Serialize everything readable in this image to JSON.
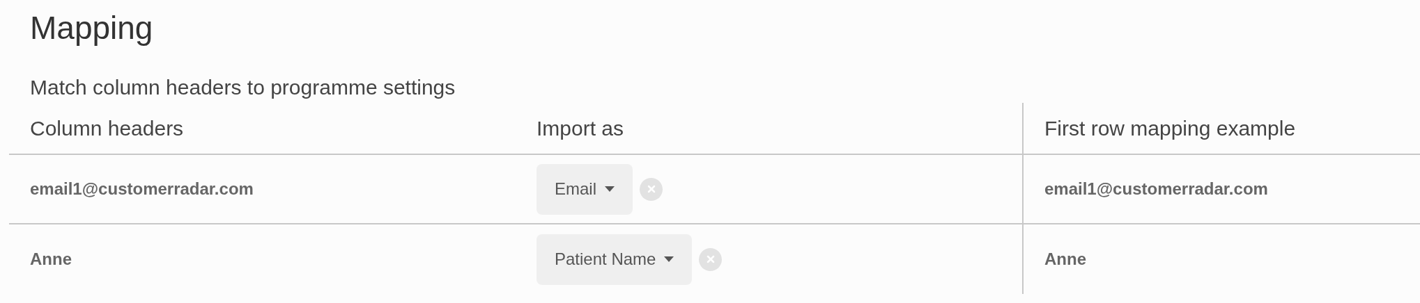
{
  "title": "Mapping",
  "subtitle": "Match column headers to programme settings",
  "table": {
    "columns": [
      "Column headers",
      "Import as",
      "First row mapping example"
    ],
    "rows": [
      {
        "header": "email1@customerradar.com",
        "import_as": "Email",
        "example": "email1@customerradar.com"
      },
      {
        "header": "Anne",
        "import_as": "Patient Name",
        "example": "Anne"
      }
    ]
  }
}
